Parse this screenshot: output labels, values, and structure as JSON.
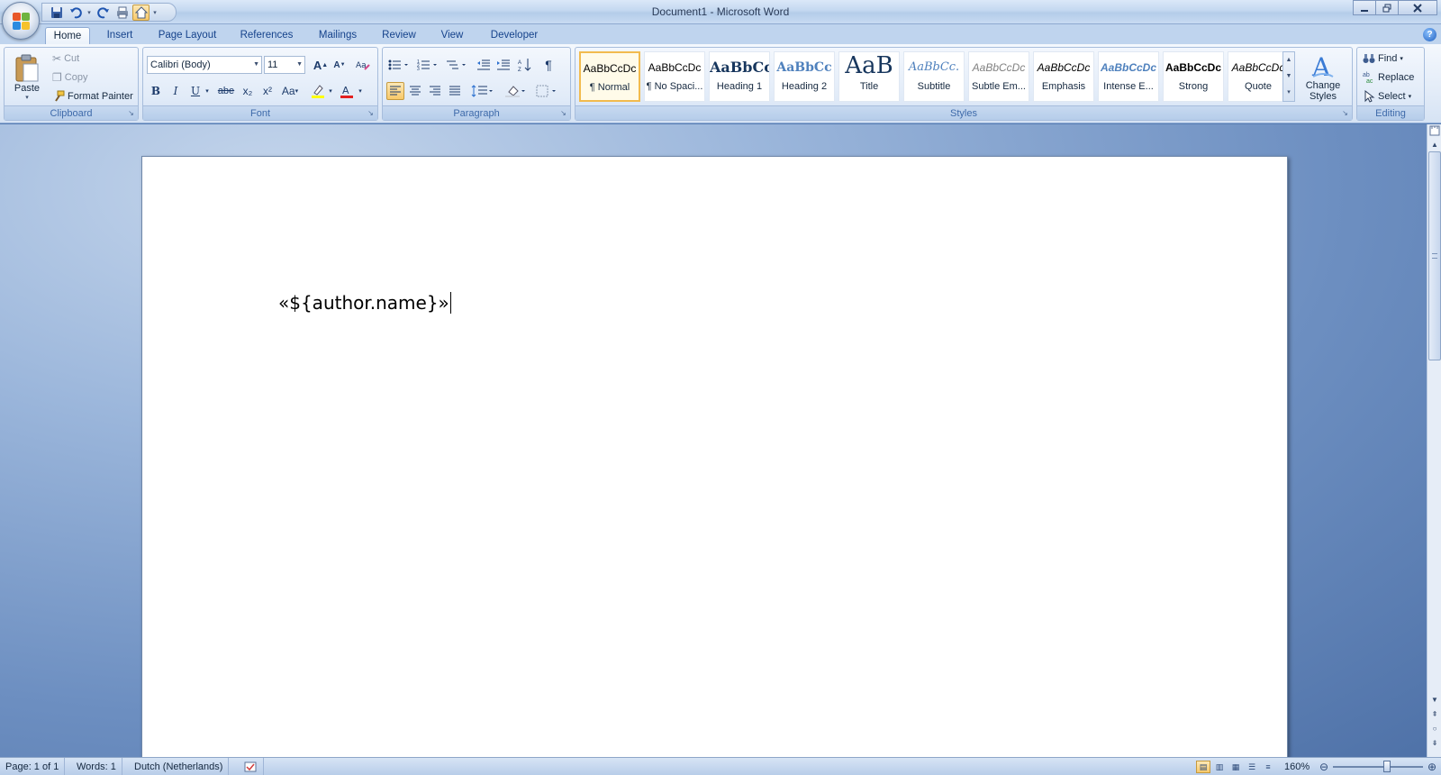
{
  "window": {
    "title": "Document1 - Microsoft Word",
    "minimize_icon": "minimize-icon",
    "restore_icon": "restore-icon",
    "close_icon": "close-icon"
  },
  "quick_access": {
    "items": [
      "save-icon",
      "undo-icon",
      "redo-icon",
      "print-icon",
      "home-icon",
      "customize-icon"
    ]
  },
  "tabs": [
    "Home",
    "Insert",
    "Page Layout",
    "References",
    "Mailings",
    "Review",
    "View",
    "Developer"
  ],
  "active_tab": "Home",
  "ribbon": {
    "clipboard": {
      "label": "Clipboard",
      "paste": "Paste",
      "cut": "Cut",
      "copy": "Copy",
      "format_painter": "Format Painter"
    },
    "font": {
      "label": "Font",
      "font_name": "Calibri (Body)",
      "font_size": "11",
      "bold": "B",
      "italic": "I",
      "underline": "U",
      "strikethrough": "abe",
      "subscript": "x₂",
      "superscript": "x²",
      "change_case": "Aa",
      "grow": "A",
      "shrink": "A"
    },
    "paragraph": {
      "label": "Paragraph",
      "pilcrow": "¶"
    },
    "styles": {
      "label": "Styles",
      "items": [
        {
          "sample": "AaBbCcDc",
          "name": "¶ Normal"
        },
        {
          "sample": "AaBbCcDc",
          "name": "¶ No Spaci..."
        },
        {
          "sample": "AaBbCc",
          "name": "Heading 1"
        },
        {
          "sample": "AaBbCc",
          "name": "Heading 2"
        },
        {
          "sample": "AaB",
          "name": "Title"
        },
        {
          "sample": "AaBbCc.",
          "name": "Subtitle"
        },
        {
          "sample": "AaBbCcDc",
          "name": "Subtle Em..."
        },
        {
          "sample": "AaBbCcDc",
          "name": "Emphasis"
        },
        {
          "sample": "AaBbCcDc",
          "name": "Intense E..."
        },
        {
          "sample": "AaBbCcDc",
          "name": "Strong"
        },
        {
          "sample": "AaBbCcDc",
          "name": "Quote"
        }
      ],
      "selected": "¶ Normal",
      "change_styles_line1": "Change",
      "change_styles_line2": "Styles"
    },
    "editing": {
      "label": "Editing",
      "find": "Find",
      "replace": "Replace",
      "select": "Select"
    }
  },
  "document": {
    "text": "«${author.name}»"
  },
  "status": {
    "page": "Page: 1 of 1",
    "words": "Words: 1",
    "language": "Dutch (Netherlands)",
    "zoom": "160%",
    "zoom_level_fraction": 0.6
  },
  "colors": {
    "ribbon_accent": "#15428b",
    "selected_style_border": "#f2bb4e",
    "workspace": "#6d8fc1"
  }
}
